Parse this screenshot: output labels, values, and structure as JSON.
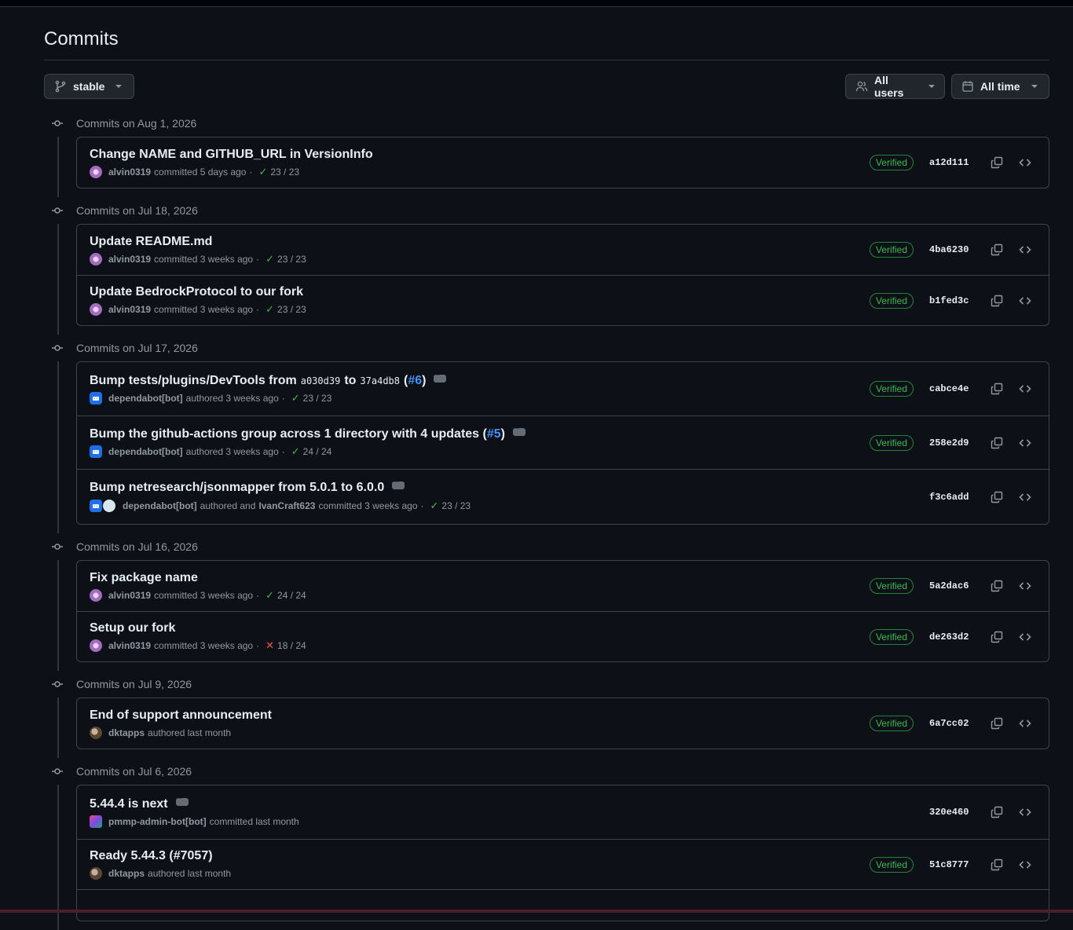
{
  "page": {
    "title": "Commits"
  },
  "branch_selector": {
    "label": "stable"
  },
  "users_filter": {
    "label": "All users"
  },
  "time_filter": {
    "label": "All time"
  },
  "groups": [
    {
      "heading": "Commits on Aug 1, 2026",
      "commits": [
        {
          "message": "Change NAME and GITHUB_URL in VersionInfo",
          "author": "alvin0319",
          "action": "committed 5 days ago",
          "checks": "23 / 23",
          "status": "pass",
          "verified": "Verified",
          "sha": "a12d111"
        }
      ]
    },
    {
      "heading": "Commits on Jul 18, 2026",
      "commits": [
        {
          "message": "Update README.md",
          "author": "alvin0319",
          "action": "committed 3 weeks ago",
          "checks": "23 / 23",
          "status": "pass",
          "verified": "Verified",
          "sha": "4ba6230"
        },
        {
          "message": "Update BedrockProtocol to our fork",
          "author": "alvin0319",
          "action": "committed 3 weeks ago",
          "checks": "23 / 23",
          "status": "pass",
          "verified": "Verified",
          "sha": "b1fed3c"
        }
      ]
    },
    {
      "heading": "Commits on Jul 17, 2026",
      "commits": [
        {
          "message_prefix": "Bump tests/plugins/DevTools from",
          "code_from": "a030d39",
          "message_mid": "to",
          "code_to": "37a4db8",
          "paren_open": "(",
          "pr_link": "#6",
          "paren_close": ")",
          "author": "dependabot[bot]",
          "action": "authored 3 weeks ago",
          "checks": "23 / 23",
          "status": "pass",
          "verified": "Verified",
          "sha": "cabce4e"
        },
        {
          "message_prefix": "Bump the github-actions group across 1 directory with 4 updates (",
          "pr_link": "#5",
          "paren_close": ")",
          "author": "dependabot[bot]",
          "action": "authored 3 weeks ago",
          "checks": "24 / 24",
          "status": "pass",
          "verified": "Verified",
          "sha": "258e2d9"
        },
        {
          "message": "Bump netresearch/jsonmapper from 5.0.1 to 6.0.0",
          "author": "dependabot[bot]",
          "action": "authored and",
          "coauthor": "IvanCraft623",
          "action2": "committed 3 weeks ago",
          "checks": "23 / 23",
          "status": "pass",
          "sha": "f3c6add"
        }
      ]
    },
    {
      "heading": "Commits on Jul 16, 2026",
      "commits": [
        {
          "message": "Fix package name",
          "author": "alvin0319",
          "action": "committed 3 weeks ago",
          "checks": "24 / 24",
          "status": "pass",
          "verified": "Verified",
          "sha": "5a2dac6"
        },
        {
          "message": "Setup our fork",
          "author": "alvin0319",
          "action": "committed 3 weeks ago",
          "checks": "18 / 24",
          "status": "fail",
          "verified": "Verified",
          "sha": "de263d2"
        }
      ]
    },
    {
      "heading": "Commits on Jul 9, 2026",
      "commits": [
        {
          "message": "End of support announcement",
          "author": "dktapps",
          "action": "authored last month",
          "verified": "Verified",
          "sha": "6a7cc02"
        }
      ]
    },
    {
      "heading": "Commits on Jul 6, 2026",
      "commits": [
        {
          "message": "5.44.4 is next",
          "author": "pmmp-admin-bot[bot]",
          "action": "committed last month",
          "sha": "320e460"
        },
        {
          "message": "Ready 5.44.3 (#7057)",
          "author": "dktapps",
          "action": "authored last month",
          "verified": "Verified",
          "sha": "51c8777"
        }
      ]
    }
  ],
  "colors": {
    "background": "#0d1117",
    "border": "#3d444d",
    "verified": "#3fb950",
    "link": "#4493f8",
    "fail": "#f85149"
  },
  "icons": {
    "commit": "git-commit-icon",
    "branch": "git-branch-icon",
    "people": "people-icon",
    "calendar": "calendar-icon",
    "copy": "copy-icon",
    "browse": "code-icon",
    "check": "check-icon",
    "x": "x-icon"
  }
}
